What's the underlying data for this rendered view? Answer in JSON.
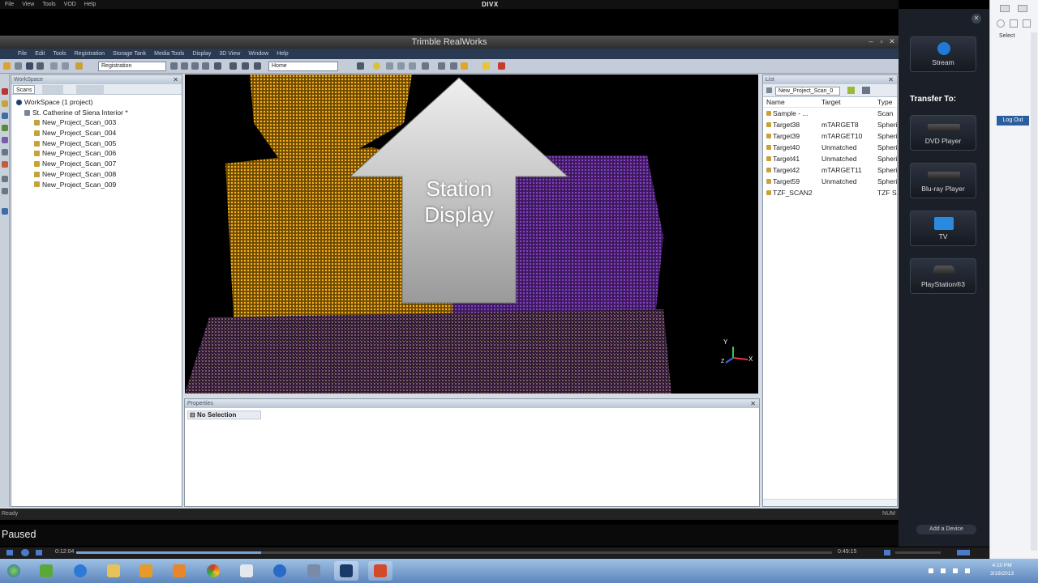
{
  "player": {
    "menu": [
      "File",
      "View",
      "Tools",
      "VOD",
      "Help"
    ],
    "logo": "DIVX",
    "status": "Paused",
    "time_current": "0:12:04",
    "time_total": "0:49:15",
    "progress_fraction": 0.245
  },
  "app": {
    "title": "Trimble RealWorks",
    "menu": [
      "File",
      "Edit",
      "Tools",
      "Registration",
      "Storage Tank",
      "Media Tools",
      "Display",
      "3D View",
      "Window",
      "Help"
    ],
    "mode_select": "Registration",
    "view_select": "Home",
    "status_text": "Ready",
    "num_indicator": "NUM"
  },
  "workspace": {
    "header": "WorkSpace",
    "tab": "Scans",
    "root": "WorkSpace  (1 project)",
    "project": "St. Catherine of Siena Interior *",
    "scans": [
      "New_Project_Scan_003",
      "New_Project_Scan_004",
      "New_Project_Scan_005",
      "New_Project_Scan_006",
      "New_Project_Scan_007",
      "New_Project_Scan_008",
      "New_Project_Scan_009"
    ]
  },
  "viewport": {
    "overlay_line1": "Station",
    "overlay_line2": "Display",
    "axis_x": "X",
    "axis_y": "Y",
    "axis_z": "Z"
  },
  "properties": {
    "header": "Properties",
    "selection": "No Selection"
  },
  "list": {
    "header": "List",
    "combo": "New_Project_Scan_0",
    "columns": [
      "Name",
      "Target",
      "Type"
    ],
    "rows": [
      [
        "Sample - ...",
        "",
        "Scan"
      ],
      [
        "Target38",
        "mTARGET8",
        "Spheri"
      ],
      [
        "Target39",
        "mTARGET10",
        "Spheri"
      ],
      [
        "Target40",
        "Unmatched",
        "Spheri"
      ],
      [
        "Target41",
        "Unmatched",
        "Spheri"
      ],
      [
        "Target42",
        "mTARGET11",
        "Spheri"
      ],
      [
        "Target59",
        "Unmatched",
        "Spheri"
      ],
      [
        "TZF_SCAN2",
        "",
        "TZF Sc"
      ]
    ]
  },
  "side_panel": {
    "stream": "Stream",
    "transfer_to": "Transfer To:",
    "devices": [
      "DVD Player",
      "Blu-ray Player",
      "TV",
      "PlayStation®3"
    ],
    "add_device": "Add a Device"
  },
  "browser": {
    "select": "Select",
    "log_out": "Log Out"
  },
  "taskbar": {
    "clock_time": "4:10 PM",
    "clock_date": "3/19/2013"
  }
}
